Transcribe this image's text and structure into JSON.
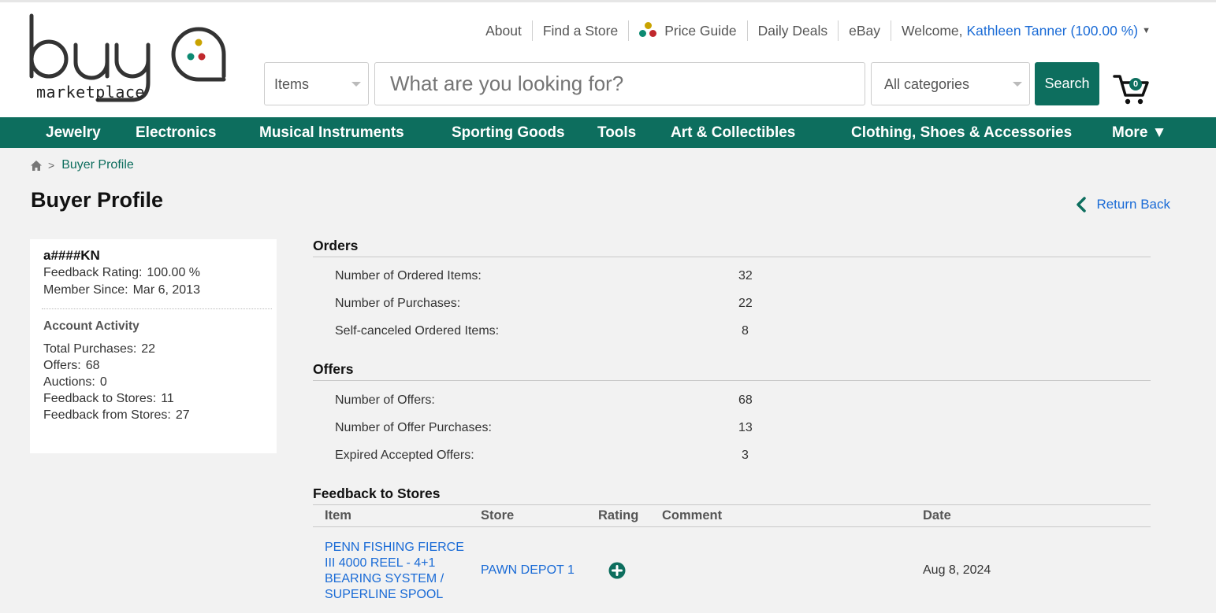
{
  "brand": {
    "logo_word": "buya",
    "logo_sub": "marketplace",
    "dot_colors": [
      "#c9a300",
      "#0d8a72",
      "#c0282d"
    ]
  },
  "toplinks": {
    "about": "About",
    "find_store": "Find a Store",
    "price_guide": "Price Guide",
    "daily_deals": "Daily Deals",
    "ebay": "eBay",
    "welcome": "Welcome,",
    "user_name": "Kathleen Tanner (100.00 %)"
  },
  "search": {
    "scope": "Items",
    "placeholder": "What are you looking for?",
    "category": "All categories",
    "button": "Search"
  },
  "cart": {
    "count": "0"
  },
  "categories": [
    "Jewelry",
    "Electronics",
    "Musical Instruments",
    "Sporting Goods",
    "Tools",
    "Art & Collectibles",
    "Clothing, Shoes & Accessories",
    "More ▼"
  ],
  "breadcrumb": {
    "separator": ">",
    "current": "Buyer Profile"
  },
  "page_title": "Buyer Profile",
  "return_label": "Return Back",
  "profile": {
    "username": "a####KN",
    "feedback_rating_label": "Feedback Rating:",
    "feedback_rating": "100.00 %",
    "member_since_label": "Member Since:",
    "member_since": "Mar 6, 2013",
    "activity_title": "Account Activity",
    "activity": [
      {
        "label": "Total Purchases:",
        "value": "22"
      },
      {
        "label": "Offers:",
        "value": "68"
      },
      {
        "label": "Auctions:",
        "value": "0"
      },
      {
        "label": "Feedback to Stores:",
        "value": "11"
      },
      {
        "label": "Feedback from Stores:",
        "value": "27"
      }
    ]
  },
  "orders": {
    "title": "Orders",
    "rows": [
      {
        "label": "Number of Ordered Items:",
        "value": "32"
      },
      {
        "label": "Number of Purchases:",
        "value": "22"
      },
      {
        "label": "Self-canceled Ordered Items:",
        "value": "8"
      }
    ]
  },
  "offers": {
    "title": "Offers",
    "rows": [
      {
        "label": "Number of Offers:",
        "value": "68"
      },
      {
        "label": "Number of Offer Purchases:",
        "value": "13"
      },
      {
        "label": "Expired Accepted Offers:",
        "value": "3"
      }
    ]
  },
  "feedback": {
    "title": "Feedback to Stores",
    "columns": [
      "Item",
      "Store",
      "Rating",
      "Comment",
      "Date"
    ],
    "rows": [
      {
        "item": "PENN FISHING FIERCE III 4000 REEL - 4+1 BEARING SYSTEM / SUPERLINE SPOOL",
        "store": "PAWN DEPOT 1",
        "rating_icon": "plus-circle-icon",
        "comment": "",
        "date": "Aug 8, 2024"
      }
    ]
  },
  "colors": {
    "brand_green": "#0d6e5e",
    "link_blue": "#1a6bd6",
    "page_bg": "#f2f2f2"
  }
}
